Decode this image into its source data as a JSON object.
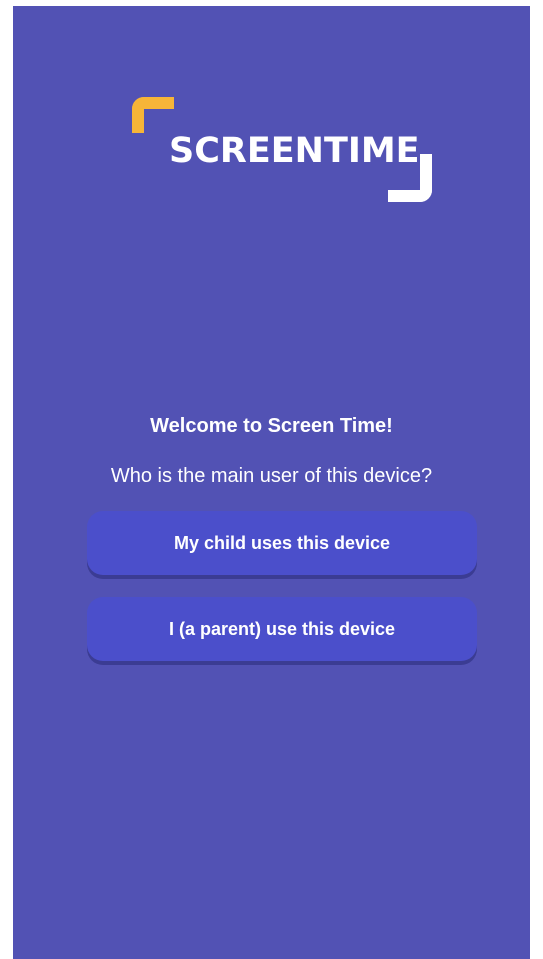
{
  "logo": {
    "text": "SCREENTIME"
  },
  "welcome": {
    "title": "Welcome to Screen Time!",
    "question": "Who is the main user of this device?"
  },
  "buttons": {
    "child": "My child uses this device",
    "parent": "I (a parent) use this device"
  },
  "colors": {
    "background": "#5252b4",
    "button": "#4b4fcb",
    "logo_accent": "#f7b538",
    "text": "#ffffff"
  }
}
